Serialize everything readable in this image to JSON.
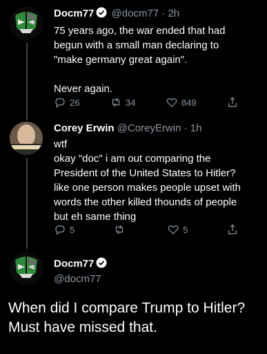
{
  "tweet1": {
    "name": "Docm77",
    "handle": "@docm77",
    "time": "· 2h",
    "lines": [
      "75 years ago, the war ended that had",
      "begun with a small man declaring to",
      "\"make germany great again\"."
    ],
    "line2": "Never again.",
    "replies": "26",
    "retweets": "34",
    "likes": "849"
  },
  "tweet2": {
    "name": "Corey Erwin",
    "handle": "@CoreyErwin",
    "time": "· 1h",
    "lines": [
      "wtf",
      "okay \"doc\" i am out  comparing the",
      "President of the United States to Hitler?",
      "like one person makes people upset with",
      "words the other killed thounds of people",
      "but eh same thing"
    ],
    "replies": "5",
    "retweets": "",
    "likes": "5"
  },
  "tweet3": {
    "name": "Docm77",
    "handle": "@docm77",
    "lines": [
      "When did I compare Trump to Hitler?",
      "Must have missed that."
    ]
  },
  "colors": {
    "background": "#000000",
    "secondary_text": "#8b98a5",
    "verified": "#ffffff",
    "thread_line": "#3d4247"
  }
}
